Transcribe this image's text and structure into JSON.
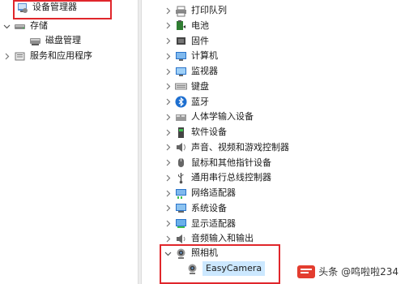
{
  "left_tree": {
    "items": [
      {
        "label": "设备管理器",
        "icon": "device-manager-icon",
        "expanded": null
      },
      {
        "label": "存储",
        "icon": "storage-icon",
        "expanded": true
      },
      {
        "label": "磁盘管理",
        "icon": "disk-management-icon",
        "expanded": null
      },
      {
        "label": "服务和应用程序",
        "icon": "services-apps-icon",
        "expanded": false
      }
    ]
  },
  "device_tree": {
    "categories": [
      {
        "label": "打印队列",
        "icon": "print-queue-icon"
      },
      {
        "label": "电池",
        "icon": "battery-icon"
      },
      {
        "label": "固件",
        "icon": "firmware-icon"
      },
      {
        "label": "计算机",
        "icon": "computer-icon"
      },
      {
        "label": "监视器",
        "icon": "monitor-icon"
      },
      {
        "label": "键盘",
        "icon": "keyboard-icon"
      },
      {
        "label": "蓝牙",
        "icon": "bluetooth-icon"
      },
      {
        "label": "人体学输入设备",
        "icon": "hid-icon"
      },
      {
        "label": "软件设备",
        "icon": "software-device-icon"
      },
      {
        "label": "声音、视频和游戏控制器",
        "icon": "sound-icon"
      },
      {
        "label": "鼠标和其他指针设备",
        "icon": "mouse-icon"
      },
      {
        "label": "通用串行总线控制器",
        "icon": "usb-icon"
      },
      {
        "label": "网络适配器",
        "icon": "network-adapter-icon"
      },
      {
        "label": "系统设备",
        "icon": "system-device-icon"
      },
      {
        "label": "显示适配器",
        "icon": "display-adapter-icon"
      },
      {
        "label": "音频输入和输出",
        "icon": "audio-io-icon"
      }
    ],
    "camera": {
      "label": "照相机",
      "icon": "camera-icon",
      "expanded": true,
      "children": [
        {
          "label": "EasyCamera",
          "icon": "webcam-icon",
          "selected": true
        }
      ]
    }
  },
  "watermark": {
    "text": "头条 @鸣啦啦234"
  },
  "colors": {
    "highlight_box": "#e0262b",
    "selection": "#cce8ff",
    "accent": "#2a73c9"
  }
}
